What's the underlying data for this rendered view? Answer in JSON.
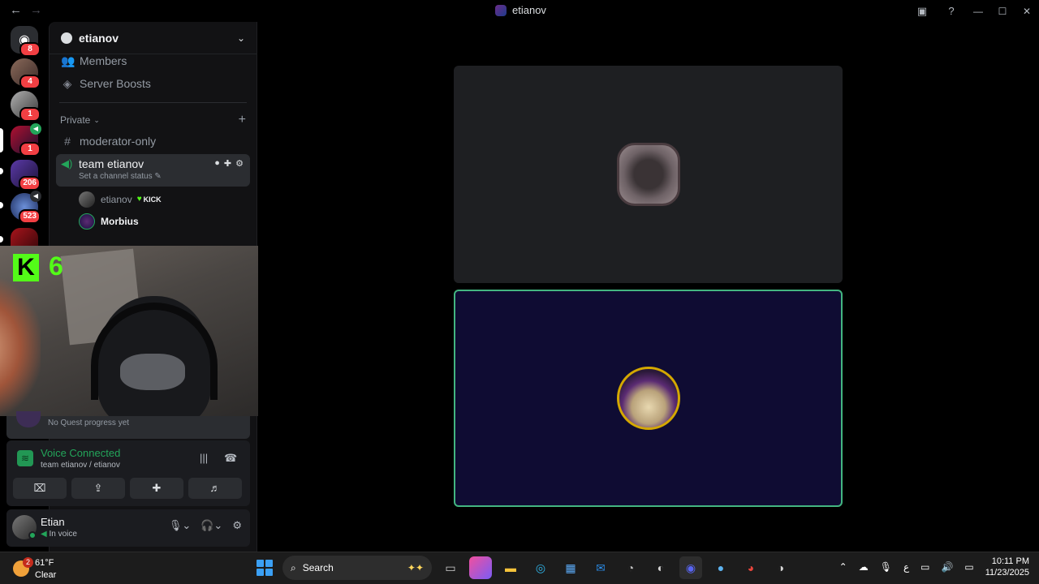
{
  "window": {
    "title": "etianov",
    "back_icon": "←",
    "forward_icon": "→",
    "minimize": "—",
    "maximize": "☐",
    "close": "✕"
  },
  "rail": {
    "servers": [
      {
        "name": "direct-messages",
        "badge": "8"
      },
      {
        "name": "server-2",
        "badge": "4"
      },
      {
        "name": "server-3",
        "badge": "1"
      },
      {
        "name": "server-4",
        "badge": "1"
      },
      {
        "name": "server-5",
        "badge": "206"
      },
      {
        "name": "server-6",
        "badge": "523"
      }
    ]
  },
  "sidebar": {
    "server_name": "etianov",
    "items": [
      {
        "label": "Members",
        "icon": "members-icon"
      },
      {
        "label": "Server Boosts",
        "icon": "boost-icon"
      }
    ],
    "category": "Private",
    "text_channel": "moderator-only",
    "voice_channel": {
      "name": "team etianov",
      "status": "Set a channel status",
      "users": [
        {
          "name": "etianov",
          "tag": "KICK"
        },
        {
          "name": "Morbius"
        }
      ]
    }
  },
  "webcam": {
    "kick_logo": "K",
    "kick_count": "6"
  },
  "quest": {
    "text": "No Quest progress yet"
  },
  "voice": {
    "title": "Voice Connected",
    "subtitle": "team etianov / etianov"
  },
  "user": {
    "name": "Etian",
    "status": "In voice"
  },
  "taskbar": {
    "weather_badge": "2",
    "temperature": "61°F",
    "condition": "Clear",
    "search_label": "Search",
    "time": "10:11 PM",
    "date": "11/23/2025"
  },
  "colors": {
    "accent_green": "#23a55a",
    "kick_green": "#53fc18",
    "speaking_border": "#43b581",
    "badge_red": "#f23f43"
  }
}
